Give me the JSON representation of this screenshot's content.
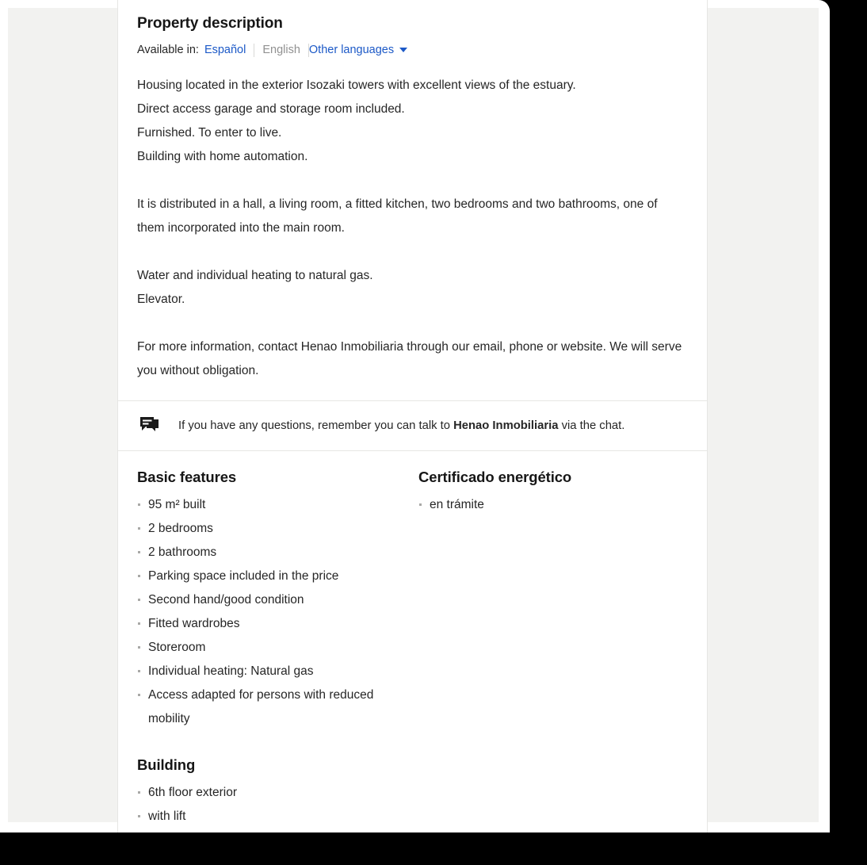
{
  "colors": {
    "link": "#1c59c7",
    "text": "#262626",
    "muted": "#919191",
    "panel_grey": "#f2f2f0",
    "divider": "#e6e6e4",
    "bullet": "#a9a9a7"
  },
  "description": {
    "title": "Property description",
    "available_label": "Available in:",
    "languages": [
      {
        "label": "Español",
        "state": "link"
      },
      {
        "label": "English",
        "state": "current"
      },
      {
        "label": "Other languages",
        "state": "dropdown"
      }
    ],
    "paragraphs": [
      [
        "Housing located in the exterior Isozaki towers with excellent views of the estuary.",
        "Direct access garage and storage room included.",
        "Furnished. To enter to live.",
        "Building with home automation."
      ],
      [
        "It is distributed in a hall, a living room, a fitted kitchen, two bedrooms and two bathrooms, one of them incorporated into the main room."
      ],
      [
        "Water and individual heating to natural gas.",
        "Elevator."
      ],
      [
        "For more information, contact Henao Inmobiliaria through our email, phone or website. We will serve you without obligation."
      ]
    ]
  },
  "chat_banner": {
    "icon": "chat-bubbles-icon",
    "text_before": "If you have any questions, remember you can talk to ",
    "agency_name": "Henao Inmobiliaria",
    "text_after": " via the chat."
  },
  "features": {
    "basic": {
      "heading": "Basic features",
      "items": [
        "95 m² built",
        "2 bedrooms",
        "2 bathrooms",
        "Parking space included in the price",
        "Second hand/good condition",
        "Fitted wardrobes",
        "Storeroom",
        "Individual heating: Natural gas",
        "Access adapted for persons with reduced mobility"
      ]
    },
    "building": {
      "heading": "Building",
      "items": [
        "6th floor exterior",
        "with lift"
      ]
    },
    "energy": {
      "heading": "Certificado energético",
      "items": [
        "en trámite"
      ]
    }
  }
}
